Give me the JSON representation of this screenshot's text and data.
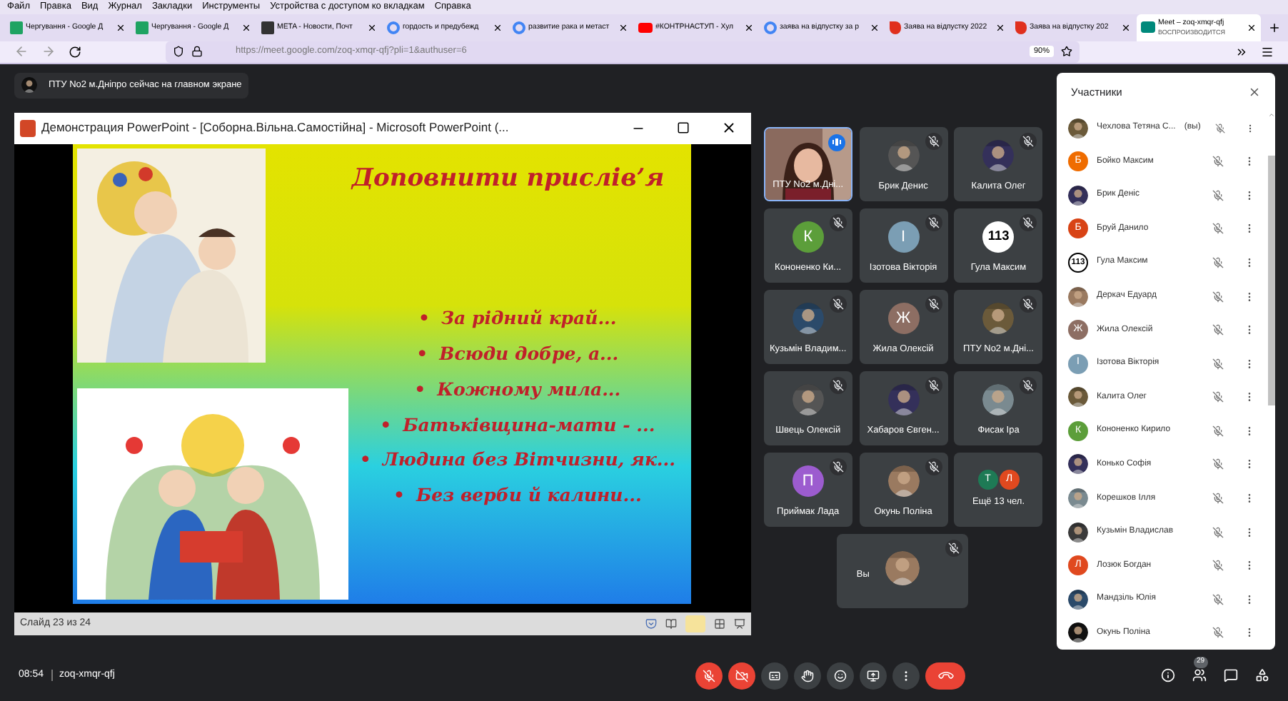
{
  "browser": {
    "menu": [
      "Файл",
      "Правка",
      "Вид",
      "Журнал",
      "Закладки",
      "Инструменты",
      "Устройства с доступом ко вкладкам",
      "Справка"
    ],
    "tabs": [
      {
        "title": "Чергування - Google Д",
        "kind": "sheets",
        "selected": false
      },
      {
        "title": "Чергування - Google Д",
        "kind": "sheets",
        "selected": false
      },
      {
        "title": "META - Новости, Почт",
        "kind": "meta",
        "selected": false
      },
      {
        "title": "гордость и предубежд",
        "kind": "google",
        "selected": false
      },
      {
        "title": "развитие рака и метаст",
        "kind": "google",
        "selected": false
      },
      {
        "title": "#КОНТРНАСТУП - Хул",
        "kind": "youtube",
        "selected": false
      },
      {
        "title": "заява на відпустку за р",
        "kind": "google",
        "selected": false
      },
      {
        "title": "Заява на відпустку 2022",
        "kind": "pdf",
        "selected": false
      },
      {
        "title": "Заява на відпустку 202",
        "kind": "pdf",
        "selected": false
      },
      {
        "title": "Meet – zoq-xmqr-qfj",
        "subtitle": "ВОСПРОИЗВОДИТСЯ",
        "kind": "meet",
        "selected": true
      }
    ],
    "url": "https://meet.google.com/zoq-xmqr-qfj?pli=1&authuser=6",
    "zoom": "90%"
  },
  "meet": {
    "presenter_notice": "ПТУ No2 м.Дніпро сейчас на главном экране",
    "presentation_window": {
      "title": "Демонстрация PowerPoint - [Соборна.Вільна.Самостійна] - Microsoft PowerPoint (...",
      "slide": {
        "title": "Доповнити прислів’я",
        "bullets": [
          {
            "mark": "•",
            "text": "За рідний край..."
          },
          {
            "mark": "•",
            "text": "Всюди добре, а..."
          },
          {
            "mark": "•",
            "text": "Кожному мила..."
          },
          {
            "mark": "•",
            "text": "Батьківщина-мати - ..."
          },
          {
            "mark": "•",
            "text": "Людина без Вітчизни, як..."
          },
          {
            "mark": "•",
            "text": "Без верби й калини..."
          }
        ]
      },
      "status": "Слайд 23 из 24"
    },
    "tiles": [
      {
        "name": "ПТУ No2 м.Дні...",
        "avatar": {
          "kind": "video"
        },
        "muted": false,
        "highlighted": true
      },
      {
        "name": "Брик Денис",
        "muted": true,
        "highlighted": false
      },
      {
        "name": "Калита Олег",
        "muted": true,
        "highlighted": false
      },
      {
        "name": "Кононенко Ки...",
        "avatar": {
          "kind": "letter",
          "text": "К",
          "color": "#5c9e3a"
        },
        "muted": true,
        "highlighted": false
      },
      {
        "name": "Ізотова Вікторія",
        "avatar": {
          "kind": "letter",
          "text": "І",
          "color": "#7b9eb4"
        },
        "muted": true,
        "highlighted": false
      },
      {
        "name": "Гула Максим",
        "avatar": {
          "kind": "number",
          "text": "113"
        },
        "muted": true,
        "highlighted": false
      },
      {
        "name": "Кузьмін Владим...",
        "muted": true,
        "highlighted": false
      },
      {
        "name": "Жила Олексій",
        "avatar": {
          "kind": "letter",
          "text": "Ж",
          "color": "#8d6e63"
        },
        "muted": true,
        "highlighted": false
      },
      {
        "name": "ПТУ No2 м.Дні...",
        "muted": true,
        "highlighted": false
      },
      {
        "name": "Швець Олексій",
        "muted": true,
        "highlighted": false
      },
      {
        "name": "Хабаров Євген...",
        "muted": true,
        "highlighted": false
      },
      {
        "name": "Фисак Іра",
        "muted": true,
        "highlighted": false
      },
      {
        "name": "Приймак Лада",
        "avatar": {
          "kind": "letter",
          "text": "П",
          "color": "#9c5ccf"
        },
        "muted": true,
        "highlighted": false
      },
      {
        "name": "Окунь Поліна",
        "muted": true,
        "highlighted": false
      }
    ],
    "overflow_tile": {
      "avatars": [
        {
          "text": "Т",
          "color": "#1e7a55"
        },
        {
          "text": "Л",
          "color": "#e0491f"
        }
      ],
      "label": "Ещё 13 чел."
    },
    "self_tile": {
      "name": "Вы",
      "muted": true
    },
    "panel": {
      "title": "Участники",
      "participants": [
        {
          "name": "Чехлова Тетяна С...",
          "suffix": "(вы)"
        },
        {
          "name": "Бойко Максим",
          "avatar": {
            "kind": "letter",
            "text": "Б",
            "color": "#ef6c00"
          }
        },
        {
          "name": "Брик Деніс"
        },
        {
          "name": "Бруй Данило",
          "avatar": {
            "kind": "letter",
            "text": "Б",
            "color": "#d84315"
          }
        },
        {
          "name": "Гула Максим",
          "avatar": {
            "kind": "number",
            "text": "113"
          }
        },
        {
          "name": "Деркач Едуард"
        },
        {
          "name": "Жила Олексій",
          "avatar": {
            "kind": "letter",
            "text": "Ж",
            "color": "#8d6e63"
          }
        },
        {
          "name": "Ізотова Вікторія",
          "avatar": {
            "kind": "letter",
            "text": "І",
            "color": "#7b9eb4"
          }
        },
        {
          "name": "Калита Олег"
        },
        {
          "name": "Кононенко Кирило",
          "avatar": {
            "kind": "letter",
            "text": "К",
            "color": "#5c9e3a"
          }
        },
        {
          "name": "Конько Софія"
        },
        {
          "name": "Корешков Ілля"
        },
        {
          "name": "Кузьмін Владислав"
        },
        {
          "name": "Лозюк Богдан",
          "avatar": {
            "kind": "letter",
            "text": "Л",
            "color": "#e0491f"
          }
        },
        {
          "name": "Мандзіль Юлія"
        },
        {
          "name": "Окунь Поліна"
        }
      ]
    },
    "bottom": {
      "time": "08:54",
      "code": "zoq-xmqr-qfj",
      "people_count": "29"
    }
  }
}
